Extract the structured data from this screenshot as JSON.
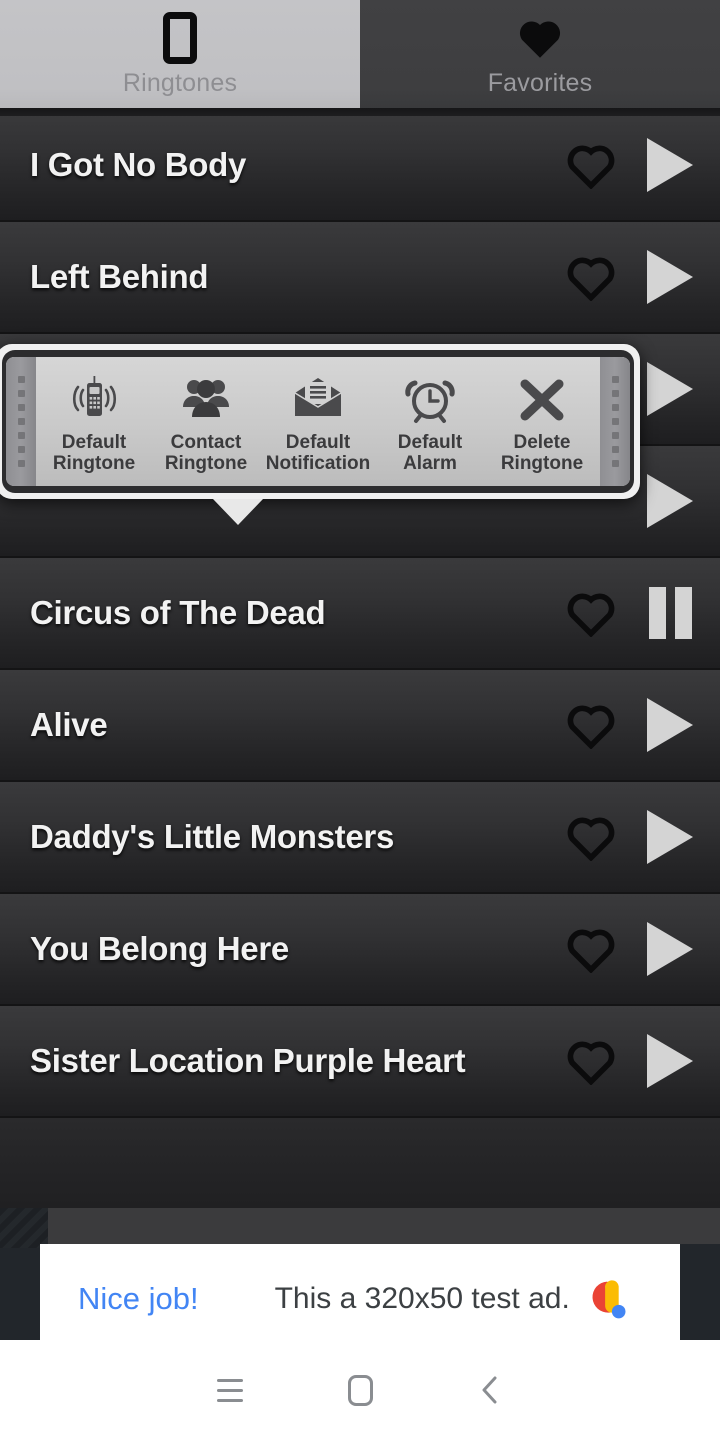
{
  "app": {
    "tabs": [
      {
        "label": "Ringtones",
        "icon": "phone-icon",
        "active": true
      },
      {
        "label": "Favorites",
        "icon": "heart-icon",
        "active": false
      }
    ]
  },
  "list": {
    "rows": [
      {
        "title": "I Got No Body",
        "favorite": false,
        "state": "play"
      },
      {
        "title": "Left Behind",
        "favorite": false,
        "state": "play"
      },
      {
        "title": "",
        "favorite": false,
        "state": "play"
      },
      {
        "title": "",
        "favorite": false,
        "state": "play"
      },
      {
        "title": "Circus of The Dead",
        "favorite": false,
        "state": "pause"
      },
      {
        "title": "Alive",
        "favorite": false,
        "state": "play"
      },
      {
        "title": "Daddy's Little Monsters",
        "favorite": false,
        "state": "play"
      },
      {
        "title": "You Belong Here",
        "favorite": false,
        "state": "play"
      },
      {
        "title": "Sister Location Purple Heart",
        "favorite": false,
        "state": "play"
      }
    ]
  },
  "popup": {
    "items": [
      {
        "label_line1": "Default",
        "label_line2": "Ringtone",
        "icon": "ringing-phone-icon"
      },
      {
        "label_line1": "Contact",
        "label_line2": "Ringtone",
        "icon": "contacts-group-icon"
      },
      {
        "label_line1": "Default",
        "label_line2": "Notification",
        "icon": "envelope-icon"
      },
      {
        "label_line1": "Default",
        "label_line2": "Alarm",
        "icon": "alarm-clock-icon"
      },
      {
        "label_line1": "Delete",
        "label_line2": "Ringtone",
        "icon": "close-x-icon"
      }
    ]
  },
  "ad": {
    "headline": "Nice job!",
    "body": "This a 320x50 test ad.",
    "logo": "admob-logo-icon"
  },
  "navbar": {
    "recents_label": "Recents",
    "home_label": "Home",
    "back_label": "Back"
  },
  "colors": {
    "tab_active_bg": "#c2c2c5",
    "tab_inactive_bg": "#3f3f41",
    "row_text": "#f2f2f2",
    "play_icon": "#d4d4d4",
    "ad_headline": "#4285f4",
    "ad_body": "#3c4043",
    "admob_red": "#ea4335",
    "admob_yellow": "#fbbc04",
    "admob_blue": "#4285f4"
  }
}
